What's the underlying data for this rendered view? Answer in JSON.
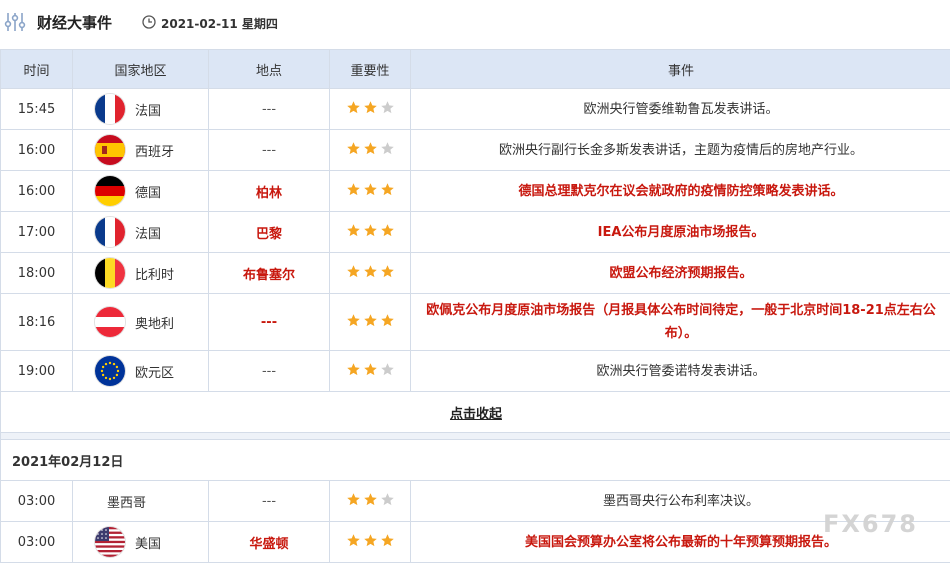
{
  "header": {
    "title": "财经大事件",
    "date": "2021-02-11 星期四"
  },
  "columns": [
    "时间",
    "国家地区",
    "地点",
    "重要性",
    "事件"
  ],
  "collapse_label": "点击收起",
  "day2_label": "2021年02月12日",
  "watermark": "FX678",
  "rows_day1": [
    {
      "time": "15:45",
      "flag": "france",
      "country": "法国",
      "location": "---",
      "stars": 2,
      "event": "欧洲央行管委维勒鲁瓦发表讲话。",
      "highlight": false
    },
    {
      "time": "16:00",
      "flag": "spain",
      "country": "西班牙",
      "location": "---",
      "stars": 2,
      "event": "欧洲央行副行长金多斯发表讲话，主题为疫情后的房地产行业。",
      "highlight": false
    },
    {
      "time": "16:00",
      "flag": "germany",
      "country": "德国",
      "location": "柏林",
      "stars": 3,
      "event": "德国总理默克尔在议会就政府的疫情防控策略发表讲话。",
      "highlight": true
    },
    {
      "time": "17:00",
      "flag": "france",
      "country": "法国",
      "location": "巴黎",
      "stars": 3,
      "event": "IEA公布月度原油市场报告。",
      "highlight": true
    },
    {
      "time": "18:00",
      "flag": "belgium",
      "country": "比利时",
      "location": "布鲁塞尔",
      "stars": 3,
      "event": "欧盟公布经济预期报告。",
      "highlight": true
    },
    {
      "time": "18:16",
      "flag": "austria",
      "country": "奥地利",
      "location": "---",
      "stars": 3,
      "event": "欧佩克公布月度原油市场报告（月报具体公布时间待定，一般于北京时间18-21点左右公布）。",
      "highlight": true
    },
    {
      "time": "19:00",
      "flag": "eu",
      "country": "欧元区",
      "location": "---",
      "stars": 2,
      "event": "欧洲央行管委诺特发表讲话。",
      "highlight": false
    }
  ],
  "rows_day2": [
    {
      "time": "03:00",
      "flag": "",
      "country": "墨西哥",
      "location": "---",
      "stars": 2,
      "event": "墨西哥央行公布利率决议。",
      "highlight": false
    },
    {
      "time": "03:00",
      "flag": "usa",
      "country": "美国",
      "location": "华盛顿",
      "stars": 3,
      "event": "美国国会预算办公室将公布最新的十年预算预期报告。",
      "highlight": true
    }
  ],
  "colors": {
    "header_bg": "#dce6f5",
    "highlight": "#c8180e",
    "star_on": "#f5a623",
    "star_off": "#cccccc"
  }
}
